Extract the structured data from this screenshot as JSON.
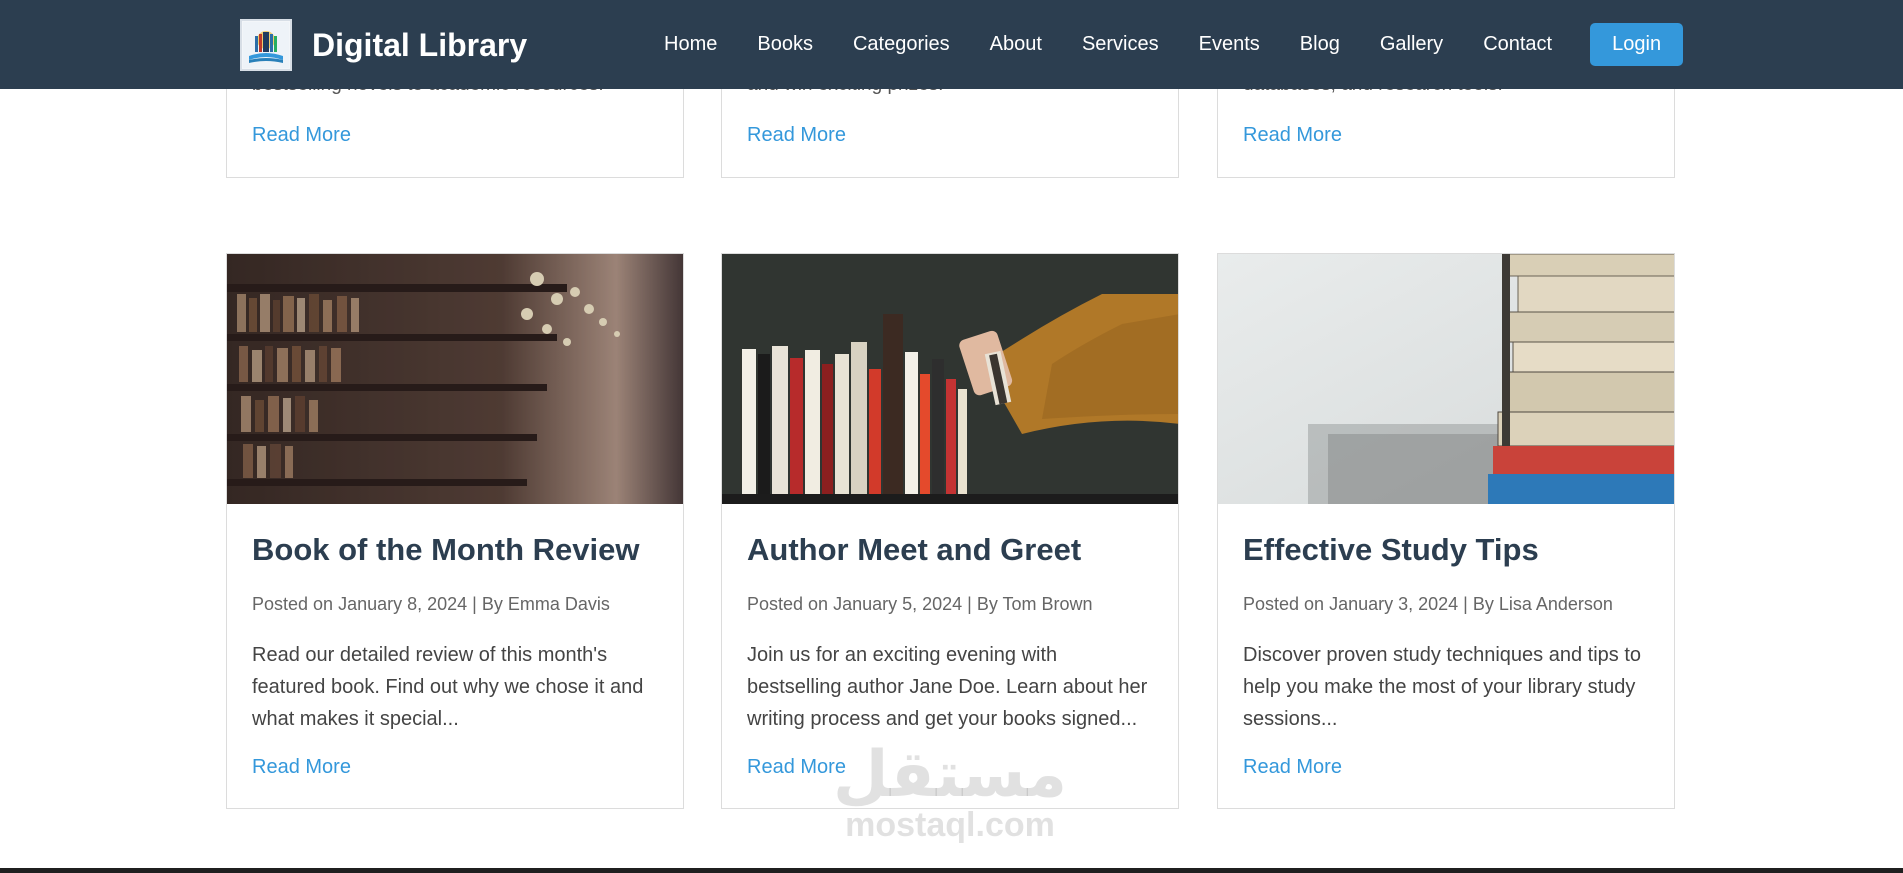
{
  "header": {
    "brand_title": "Digital Library",
    "nav": [
      "Home",
      "Books",
      "Categories",
      "About",
      "Services",
      "Events",
      "Blog",
      "Gallery",
      "Contact"
    ],
    "login_label": "Login",
    "colors": {
      "background": "#2c3e50",
      "accent": "#3498db"
    }
  },
  "top_cards": [
    {
      "snippet": "bestselling novels to academic resources.",
      "read_more": "Read More"
    },
    {
      "snippet": "and win exciting prizes.",
      "read_more": "Read More"
    },
    {
      "snippet": "databases, and research tools.",
      "read_more": "Read More"
    }
  ],
  "posts": [
    {
      "image": "library-bookshelves-photo",
      "title": "Book of the Month Review",
      "meta": "Posted on January 8, 2024 | By Emma Davis",
      "excerpt": "Read our detailed review of this month's featured book. Find out why we chose it and what makes it special...",
      "read_more": "Read More"
    },
    {
      "image": "hand-picking-book-photo",
      "title": "Author Meet and Greet",
      "meta": "Posted on January 5, 2024 | By Tom Brown",
      "excerpt": "Join us for an exciting evening with bestselling author Jane Doe. Learn about her writing process and get your books signed...",
      "read_more": "Read More"
    },
    {
      "image": "stacked-books-photo",
      "title": "Effective Study Tips",
      "meta": "Posted on January 3, 2024 | By Lisa Anderson",
      "excerpt": "Discover proven study techniques and tips to help you make the most of your library study sessions...",
      "read_more": "Read More"
    }
  ],
  "watermark": {
    "arabic": "مستقل",
    "latin": "mostaql.com"
  }
}
